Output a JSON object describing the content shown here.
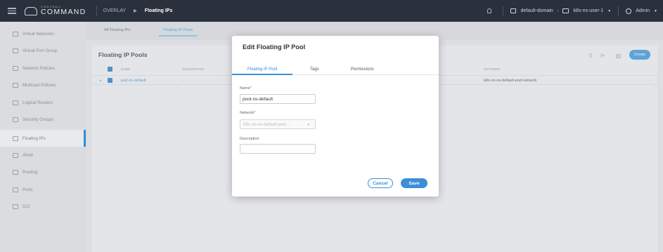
{
  "topbar": {
    "logo_small": "CONTRAIL",
    "logo_big": "COMMAND",
    "breadcrumb_section": "OVERLAY",
    "breadcrumb_page": "Floating IPs",
    "domain": "default-domain",
    "project": "k8s-ns-user-1",
    "user": "Admin"
  },
  "sidebar": {
    "items": [
      {
        "label": "Virtual Networks",
        "icon": "network-icon"
      },
      {
        "label": "Virtual Port Group",
        "icon": "port-group-icon"
      },
      {
        "label": "Network Policies",
        "icon": "policy-icon"
      },
      {
        "label": "Multicast Policies",
        "icon": "multicast-icon"
      },
      {
        "label": "Logical Routers",
        "icon": "router-icon"
      },
      {
        "label": "Security Groups",
        "icon": "security-icon"
      },
      {
        "label": "Floating IPs",
        "icon": "floating-ip-icon",
        "active": true
      },
      {
        "label": "IPAM",
        "icon": "ipam-icon"
      },
      {
        "label": "Routing",
        "icon": "routing-icon"
      },
      {
        "label": "Ports",
        "icon": "ports-icon"
      },
      {
        "label": "DCI",
        "icon": "dci-icon"
      }
    ]
  },
  "main": {
    "tabs": [
      {
        "label": "All Floating IPs"
      },
      {
        "label": "Floating IP Pools",
        "active": true
      }
    ],
    "panel_title": "Floating IP Pools",
    "create_label": "Create",
    "columns": [
      "NAME",
      "DESCRIPTION",
      "NETWORK"
    ],
    "rows": [
      {
        "name": "pod-ns-default",
        "description": "-",
        "network": "k8s-vn-ns-default-pod-network",
        "more": "···"
      }
    ]
  },
  "modal": {
    "title": "Edit Floating IP Pool",
    "tabs": [
      "Floating IP Pool",
      "Tags",
      "Permissions"
    ],
    "name_label": "Name",
    "name_value": "pool-ns-default",
    "network_label": "Network",
    "network_value": "k8s-vn-ns-default-pod-...",
    "description_label": "Description",
    "description_value": "",
    "required_mark": "*",
    "cancel_label": "Cancel",
    "save_label": "Save"
  },
  "colors": {
    "topbar": "#2a313c",
    "accent": "#3b8fd9",
    "required": "#d9534f"
  }
}
